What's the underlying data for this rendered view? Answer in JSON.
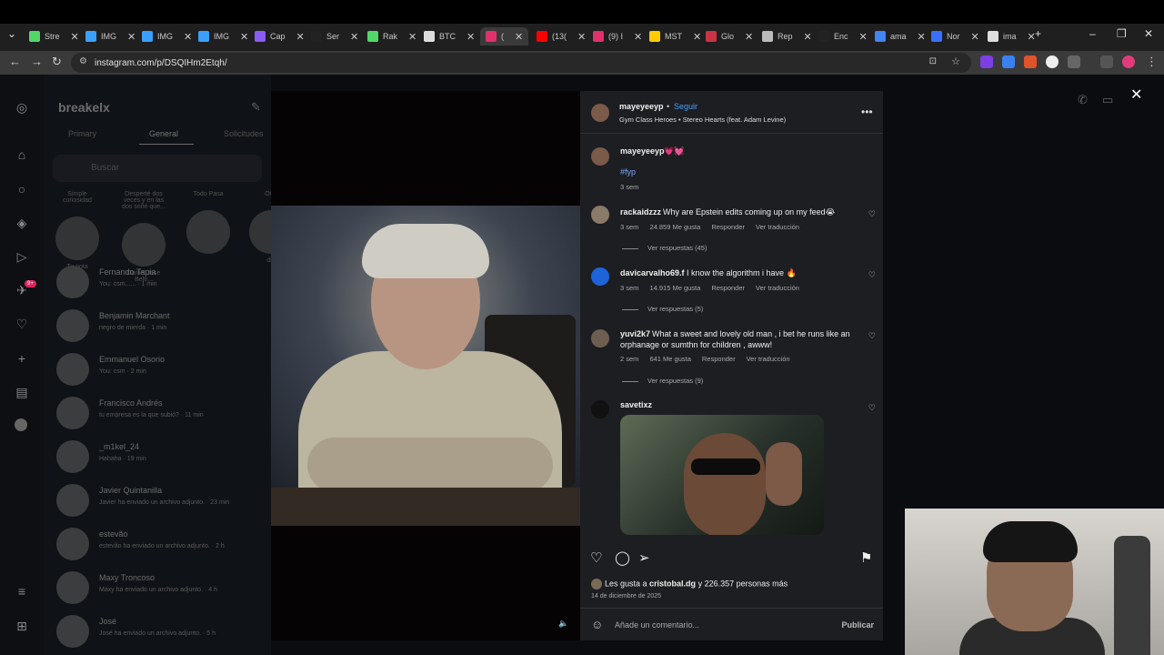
{
  "browser": {
    "tabs": [
      {
        "label": "Stre",
        "color": "#53d769"
      },
      {
        "label": "IMG",
        "color": "#3aa0ff"
      },
      {
        "label": "IMG",
        "color": "#3aa0ff"
      },
      {
        "label": "IMG",
        "color": "#3aa0ff"
      },
      {
        "label": "Cap",
        "color": "#8a5cf6"
      },
      {
        "label": "Ser",
        "color": "#222222"
      },
      {
        "label": "Rak",
        "color": "#53d769"
      },
      {
        "label": "BTC",
        "color": "#dddddd"
      },
      {
        "label": "(",
        "color": "#e1306c"
      },
      {
        "label": "(13(",
        "color": "#ff0000"
      },
      {
        "label": "(9) I",
        "color": "#e1306c"
      },
      {
        "label": "MST",
        "color": "#ffcc00"
      },
      {
        "label": "Glo",
        "color": "#cc3344"
      },
      {
        "label": "Rep",
        "color": "#bbbbbb"
      },
      {
        "label": "Enc",
        "color": "#222222"
      },
      {
        "label": "ama",
        "color": "#4285f4"
      },
      {
        "label": "Nor",
        "color": "#3a70ff"
      },
      {
        "label": "ima",
        "color": "#dddddd"
      }
    ],
    "url": "instagram.com/p/DSQIHm2Etqh/"
  },
  "dm": {
    "account": "breakelx",
    "tabs": [
      "Primary",
      "General",
      "Solicitudes"
    ],
    "search_placeholder": "Buscar",
    "stories": [
      {
        "note": "Simple curiosidad",
        "name": "Tu nota"
      },
      {
        "note": "Desperté dos veces y en las dos soñé que...",
        "name": "Daniel Jose Beltr..."
      },
      {
        "note": "Todo Pasa",
        "name": ""
      },
      {
        "note": "Otro",
        "name": "die"
      }
    ],
    "conversations": [
      {
        "name": "Fernando Tapia",
        "sub": "You: csm...... · 1 min"
      },
      {
        "name": "Benjamin Marchant",
        "sub": "negro de mierda · 1 min"
      },
      {
        "name": "Emmanuel Osorio",
        "sub": "You: csm · 2 min"
      },
      {
        "name": "Francisco Andrés",
        "sub": "tu empresa es la que subió? · 11 min"
      },
      {
        "name": "_m1kel_24",
        "sub": "Hahaha · 19 min"
      },
      {
        "name": "Javier Quintanilla",
        "sub": "Javier ha enviado un archivo adjunto. · 23 min"
      },
      {
        "name": "estevão",
        "sub": "estevão ha enviado un archivo adjunto. · 2 h"
      },
      {
        "name": "Maxy Troncoso",
        "sub": "Maxy ha enviado un archivo adjunto. · 4 h"
      },
      {
        "name": "José",
        "sub": "José ha enviado un archivo adjunto. · 5 h"
      }
    ],
    "notification_badge": "9+"
  },
  "post": {
    "author": "mayeyeeyp",
    "follow": "Seguir",
    "audio": "Gym Class Heroes • Stereo Hearts (feat. Adam Levine)",
    "caption_user": "mayeyeeyp",
    "caption_emoji": "💗💓",
    "hashtag": "#fyp",
    "caption_time": "3 sem",
    "comments": [
      {
        "user": "rackaidzzz",
        "text": "Why are Epstein edits coming up on my feed😭",
        "time": "3 sem",
        "likes": "24.859 Me gusta",
        "reply": "Responder",
        "translate": "Ver traducción",
        "replies": "Ver respuestas (45)"
      },
      {
        "user": "davicarvalho69.f",
        "text": "I know the algorithm i have 🔥",
        "time": "3 sem",
        "likes": "14.915 Me gusta",
        "reply": "Responder",
        "translate": "Ver traducción",
        "replies": "Ver respuestas (5)"
      },
      {
        "user": "yuvi2k7",
        "text": "What a sweet and lovely old man , i bet he runs like an",
        "text2": "orphanage or sumthn for children , awww!",
        "time": "2 sem",
        "likes": "641 Me gusta",
        "reply": "Responder",
        "translate": "Ver traducción",
        "replies": "Ver respuestas (9)"
      },
      {
        "user": "savetixz"
      }
    ],
    "likes_line_prefix": "Les gusta a ",
    "likes_user": "cristobal.dg",
    "likes_line_suffix": " y 226.357 personas más",
    "date": "14 de diciembre de 2025",
    "comment_placeholder": "Añade un comentario...",
    "publish": "Publicar"
  }
}
